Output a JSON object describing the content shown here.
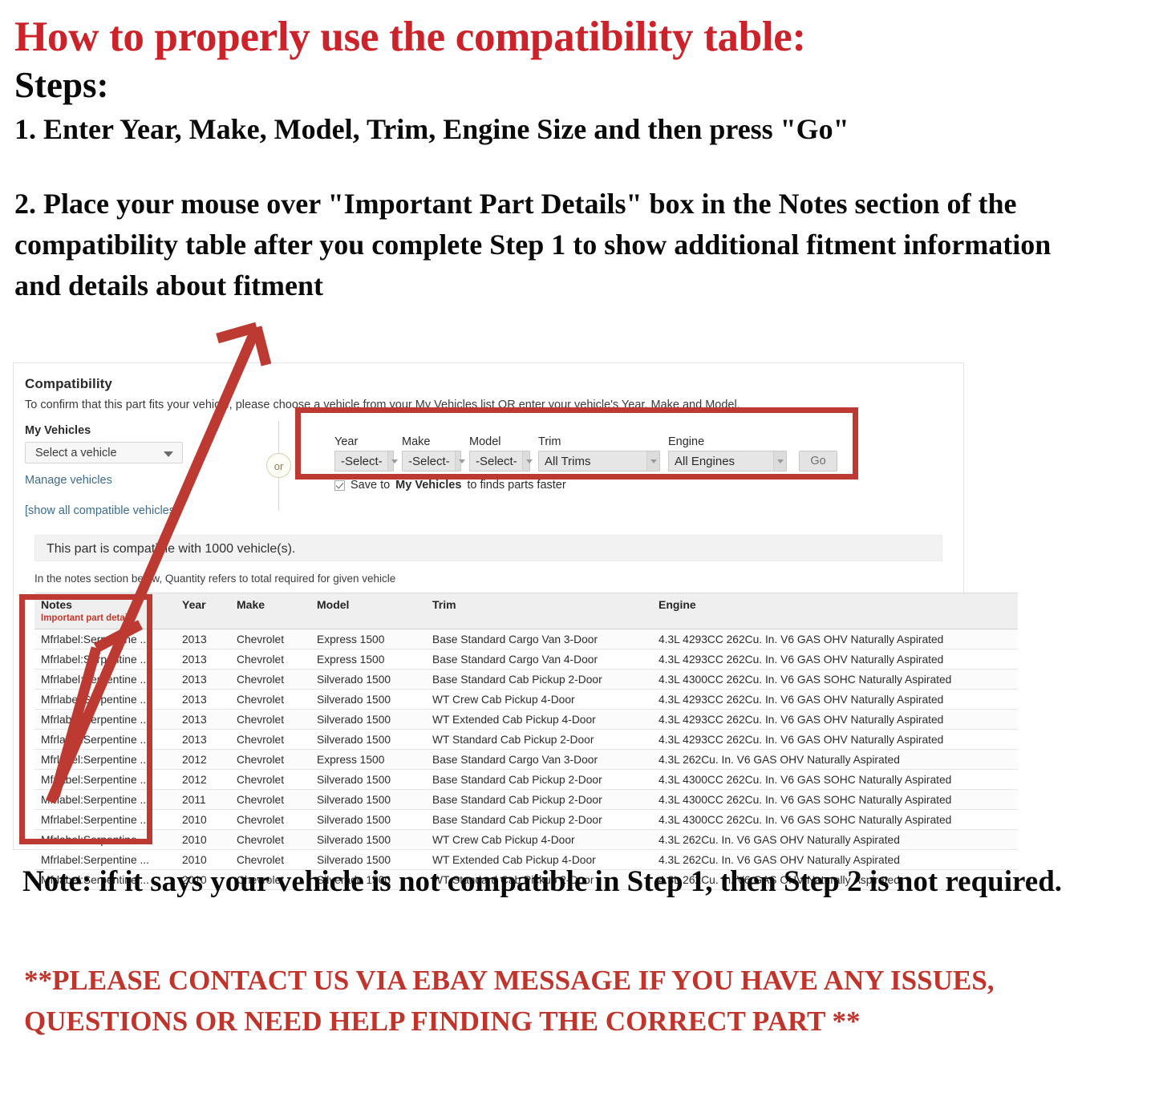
{
  "instructions": {
    "title": "How to properly use the compatibility table:",
    "steps_heading": "Steps:",
    "step1": "1. Enter Year, Make, Model, Trim, Engine Size and then press \"Go\"",
    "step2": "2. Place your mouse over \"Important Part Details\" box in the Notes section of the compatibility table after you complete Step 1 to show additional fitment information and details about fitment",
    "note": "Note: if it says your vehicle is not compatible in Step 1, then Step 2 is not required.",
    "contact": "**PLEASE CONTACT US VIA EBAY MESSAGE IF YOU HAVE ANY ISSUES, QUESTIONS OR NEED HELP FINDING THE CORRECT PART **"
  },
  "colors": {
    "title_red": "#CC2229",
    "annotation_red": "#BC3A32",
    "contact_red": "#C0342C",
    "link_blue": "#3E6B8C",
    "important_red": "#C0392B"
  },
  "compatibility": {
    "heading": "Compatibility",
    "subheading": "To confirm that this part fits your vehicle, please choose a vehicle from your My Vehicles list OR enter your vehicle's Year, Make and Model.",
    "my_vehicles_label": "My Vehicles",
    "vehicle_select_value": "Select a vehicle",
    "manage_vehicles_link": "Manage vehicles",
    "show_all_link": "[show all compatible vehicles]",
    "or_divider": "or",
    "finder": {
      "fields": [
        {
          "label": "Year",
          "value": "-Select-"
        },
        {
          "label": "Make",
          "value": "-Select-"
        },
        {
          "label": "Model",
          "value": "-Select-"
        },
        {
          "label": "Trim",
          "value": "All Trims"
        },
        {
          "label": "Engine",
          "value": "All Engines"
        }
      ],
      "go_label": "Go",
      "save_checkbox_checked": true,
      "save_text_before": "Save to ",
      "save_text_bold": "My Vehicles",
      "save_text_after": " to finds parts faster"
    },
    "compatible_banner": "This part is compatible with 1000 vehicle(s).",
    "notes_hint": "In the notes section below, Quantity refers to total required for given vehicle",
    "table": {
      "headers": [
        "Notes",
        "Year",
        "Make",
        "Model",
        "Trim",
        "Engine"
      ],
      "notes_subheader": "Important part details",
      "rows": [
        [
          "Mfrlabel:Serpentine ...",
          "2013",
          "Chevrolet",
          "Express 1500",
          "Base Standard Cargo Van 3-Door",
          "4.3L 4293CC 262Cu. In. V6 GAS OHV Naturally Aspirated"
        ],
        [
          "Mfrlabel:Serpentine ...",
          "2013",
          "Chevrolet",
          "Express 1500",
          "Base Standard Cargo Van 4-Door",
          "4.3L 4293CC 262Cu. In. V6 GAS OHV Naturally Aspirated"
        ],
        [
          "Mfrlabel:Serpentine ...",
          "2013",
          "Chevrolet",
          "Silverado 1500",
          "Base Standard Cab Pickup 2-Door",
          "4.3L 4300CC 262Cu. In. V6 GAS SOHC Naturally Aspirated"
        ],
        [
          "Mfrlabel:Serpentine ...",
          "2013",
          "Chevrolet",
          "Silverado 1500",
          "WT Crew Cab Pickup 4-Door",
          "4.3L 4293CC 262Cu. In. V6 GAS OHV Naturally Aspirated"
        ],
        [
          "Mfrlabel:Serpentine ...",
          "2013",
          "Chevrolet",
          "Silverado 1500",
          "WT Extended Cab Pickup 4-Door",
          "4.3L 4293CC 262Cu. In. V6 GAS OHV Naturally Aspirated"
        ],
        [
          "Mfrlabel:Serpentine ...",
          "2013",
          "Chevrolet",
          "Silverado 1500",
          "WT Standard Cab Pickup 2-Door",
          "4.3L 4293CC 262Cu. In. V6 GAS OHV Naturally Aspirated"
        ],
        [
          "Mfrlabel:Serpentine ...",
          "2012",
          "Chevrolet",
          "Express 1500",
          "Base Standard Cargo Van 3-Door",
          "4.3L 262Cu. In. V6 GAS OHV Naturally Aspirated"
        ],
        [
          "Mfrlabel:Serpentine ...",
          "2012",
          "Chevrolet",
          "Silverado 1500",
          "Base Standard Cab Pickup 2-Door",
          "4.3L 4300CC 262Cu. In. V6 GAS SOHC Naturally Aspirated"
        ],
        [
          "Mfrlabel:Serpentine ...",
          "2011",
          "Chevrolet",
          "Silverado 1500",
          "Base Standard Cab Pickup 2-Door",
          "4.3L 4300CC 262Cu. In. V6 GAS SOHC Naturally Aspirated"
        ],
        [
          "Mfrlabel:Serpentine ...",
          "2010",
          "Chevrolet",
          "Silverado 1500",
          "Base Standard Cab Pickup 2-Door",
          "4.3L 4300CC 262Cu. In. V6 GAS SOHC Naturally Aspirated"
        ],
        [
          "Mfrlabel:Serpentine ...",
          "2010",
          "Chevrolet",
          "Silverado 1500",
          "WT Crew Cab Pickup 4-Door",
          "4.3L 262Cu. In. V6 GAS OHV Naturally Aspirated"
        ],
        [
          "Mfrlabel:Serpentine ...",
          "2010",
          "Chevrolet",
          "Silverado 1500",
          "WT Extended Cab Pickup 4-Door",
          "4.3L 262Cu. In. V6 GAS OHV Naturally Aspirated"
        ],
        [
          "Mfrlabel:Serpentine ...",
          "2010",
          "Chevrolet",
          "Silverado 1500",
          "WT Standard Cab Pickup 2-Door",
          "4.3L 262Cu. In. V6 GAS OHV Naturally Aspirated"
        ]
      ]
    }
  }
}
